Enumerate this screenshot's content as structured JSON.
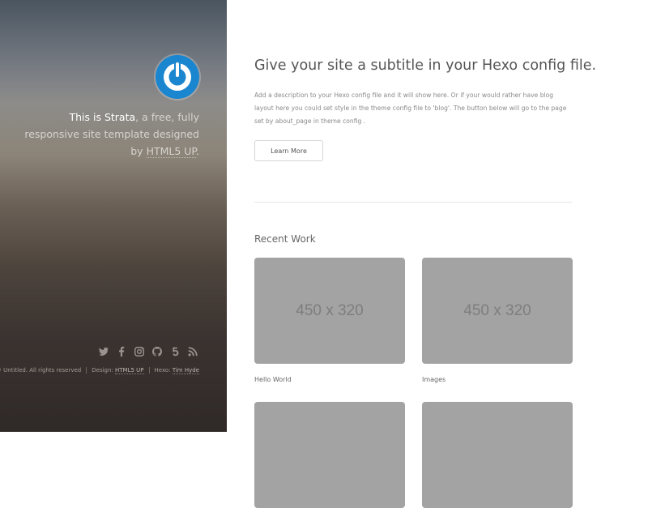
{
  "sidebar": {
    "intro": {
      "brand": "This is Strata",
      "text_middle": ", a free, fully responsive site template designed by ",
      "link": "HTML5 UP",
      "end": "."
    },
    "social_icons": [
      "twitter-icon",
      "facebook-icon",
      "instagram-icon",
      "github-icon",
      "500px-icon",
      "rss-icon"
    ],
    "credits": {
      "copyright": "© Untitled. All rights reserved",
      "design_label": "Design: ",
      "design_link": "HTML5 UP",
      "hexo_label": "Hexo: ",
      "hexo_link": "Tim Hyde"
    }
  },
  "main": {
    "headline": "Give your site a subtitle in your Hexo config file.",
    "description": "Add a description to your Hexo config file and it will show here. Or if your would rather have blog layout here you could set style in the theme config file to 'blog'. The button below will go to the page set by about_page in theme config .",
    "button_label": "Learn More",
    "section_title": "Recent Work",
    "works": [
      {
        "placeholder": "450 x 320",
        "caption": "Hello World"
      },
      {
        "placeholder": "450 x 320",
        "caption": "Images"
      },
      {
        "placeholder": "",
        "caption": ""
      },
      {
        "placeholder": "",
        "caption": ""
      }
    ]
  },
  "colors": {
    "avatar_blue": "#1a86cf",
    "thumb_gray": "#a3a3a3"
  }
}
